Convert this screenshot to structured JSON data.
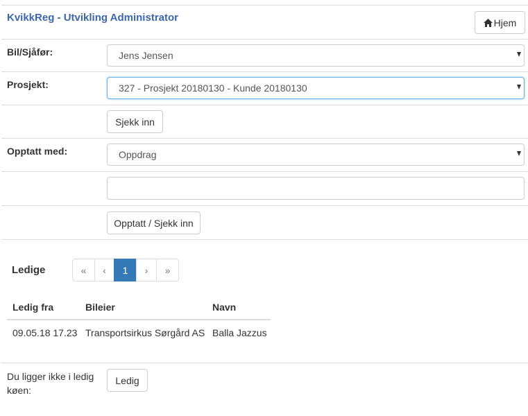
{
  "header": {
    "title": "KvikkReg - Utvikling Administrator",
    "home_label": "Hjem"
  },
  "form": {
    "driver": {
      "label": "Bil/Sjåfør:",
      "value": "Jens Jensen"
    },
    "project": {
      "label": "Prosjekt:",
      "value": "327 - Prosjekt 20180130 - Kunde 20180130"
    },
    "checkin_label": "Sjekk inn",
    "busy": {
      "label": "Opptatt med:",
      "value": "Oppdrag"
    },
    "note": {
      "value": ""
    },
    "busy_checkin_label": "Opptatt / Sjekk inn"
  },
  "ledige": {
    "title": "Ledige",
    "pagination": [
      "«",
      "‹",
      "1",
      "›",
      "»"
    ],
    "active_page": "1",
    "columns": [
      "Ledig fra",
      "Bileier",
      "Navn"
    ],
    "rows": [
      [
        "09.05.18 17.23",
        "Transportsirkus Sørgård AS",
        "Balla Jazzus"
      ]
    ]
  },
  "queue": {
    "text": "Du ligger ikke i ledig køen:",
    "button_label": "Ledig"
  }
}
